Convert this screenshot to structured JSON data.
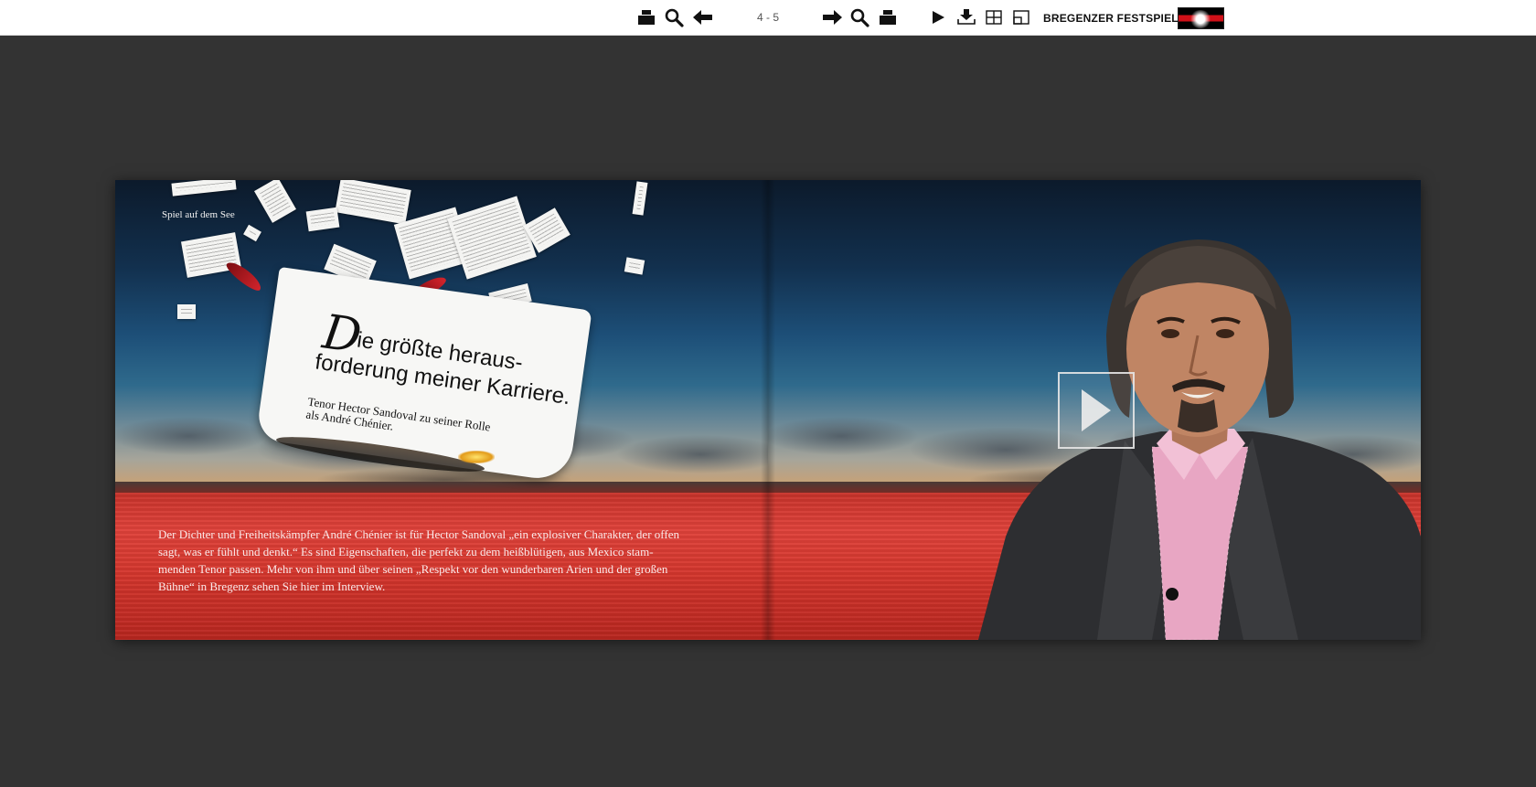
{
  "toolbar": {
    "page_indicator": "4 - 5",
    "brand_name": "BREGENZER FESTSPIELE",
    "icons": [
      "print-icon",
      "zoom-icon",
      "arrow-left-icon",
      "arrow-right-icon",
      "zoom-icon",
      "print-icon",
      "play-icon",
      "download-icon",
      "grid-icon",
      "fullscreen-icon"
    ]
  },
  "left_page": {
    "kicker": "Spiel auf dem See",
    "headline_initial": "D",
    "headline_line1": "ie größte heraus-",
    "headline_line2": "forderung meiner Karriere.",
    "sub_line1": "Tenor Hector Sandoval zu seiner Rolle",
    "sub_line2": "als André Chénier.",
    "body_lines": [
      "Der Dichter und Freiheitskämpfer André Chénier ist für Hector Sandoval „ein explosiver Charakter, der offen",
      "sagt, was er fühlt und denkt.“ Es sind Eigenschaften, die perfekt zu dem heißblütigen, aus Mexico stam-",
      "menden Tenor passen. Mehr von ihm und über seinen „Respekt vor den wunderbaren Arien und der großen",
      "Bühne“ in Bregenz sehen Sie hier im Interview."
    ]
  },
  "colors": {
    "background": "#333333",
    "sea_red": "#d4362d",
    "sky_blue": "#1d4f78"
  }
}
